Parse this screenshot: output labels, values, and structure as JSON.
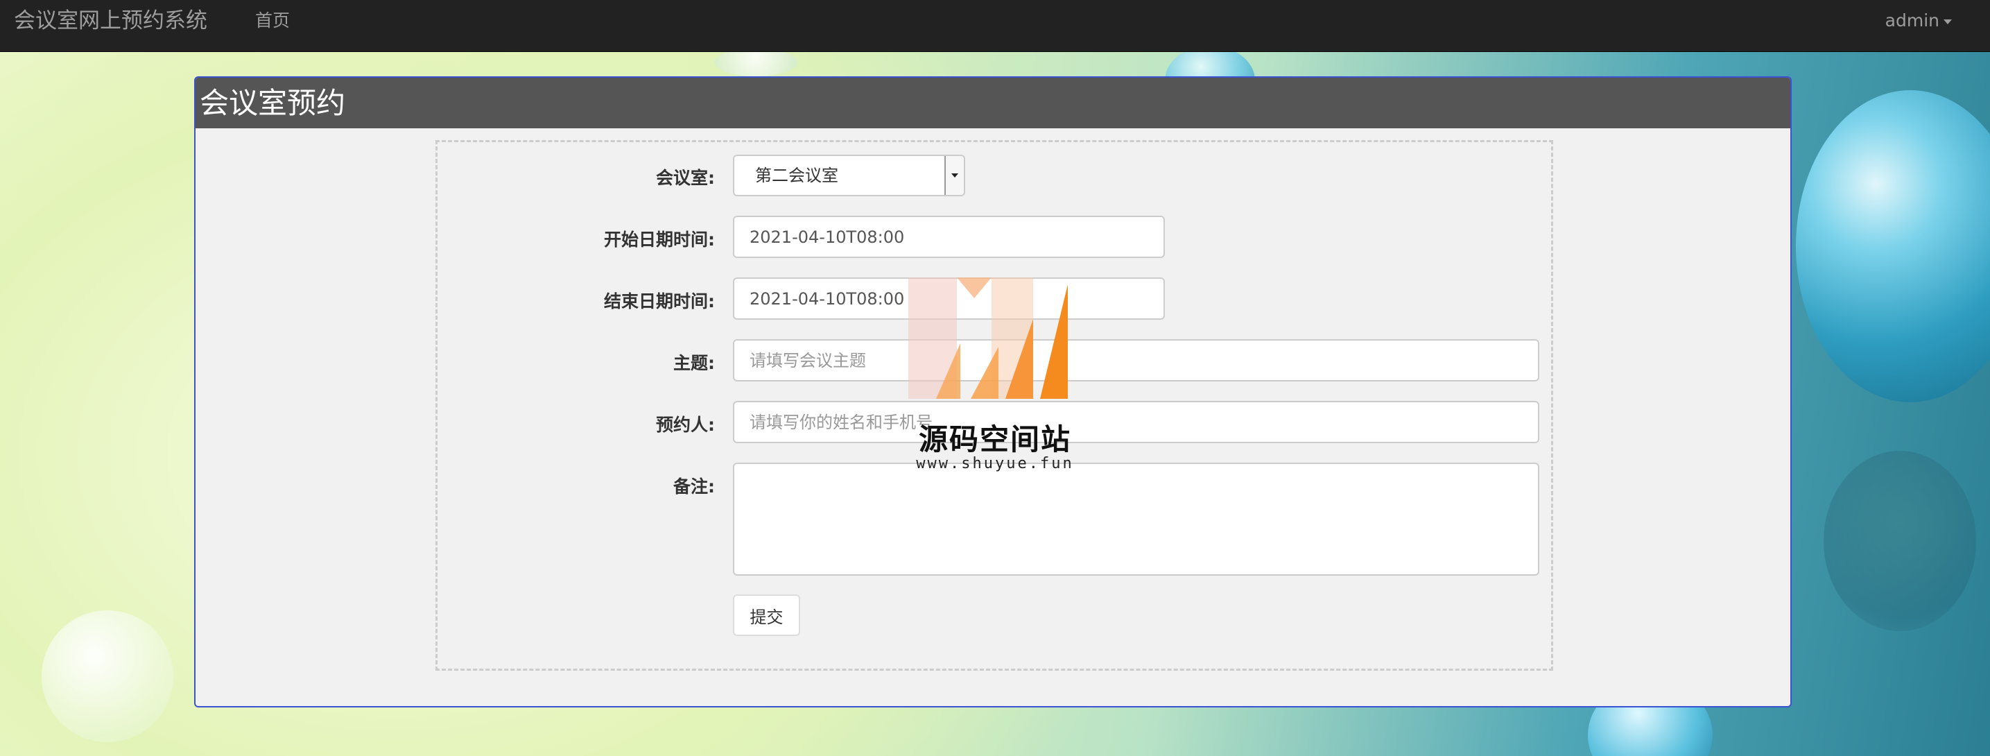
{
  "navbar": {
    "brand": "会议室网上预约系统",
    "home": "首页",
    "user": "admin"
  },
  "panel": {
    "title": "会议室预约"
  },
  "form": {
    "room": {
      "label": "会议室:",
      "value": "第二会议室"
    },
    "start": {
      "label": "开始日期时间:",
      "value": "2021-04-10T08:00"
    },
    "end": {
      "label": "结束日期时间:",
      "value": "2021-04-10T08:00"
    },
    "subject": {
      "label": "主题:",
      "placeholder": "请填写会议主题"
    },
    "booker": {
      "label": "预约人:",
      "placeholder": "请填写你的姓名和手机号"
    },
    "note": {
      "label": "备注:"
    },
    "submit": "提交"
  },
  "watermark": {
    "title": "源码空间站",
    "url": "www.shuyue.fun"
  },
  "colors": {
    "navbar": "#222222",
    "panel_heading": "#555555",
    "panel_border": "#3b53d0",
    "watermark_orange": "#f58a1f"
  }
}
